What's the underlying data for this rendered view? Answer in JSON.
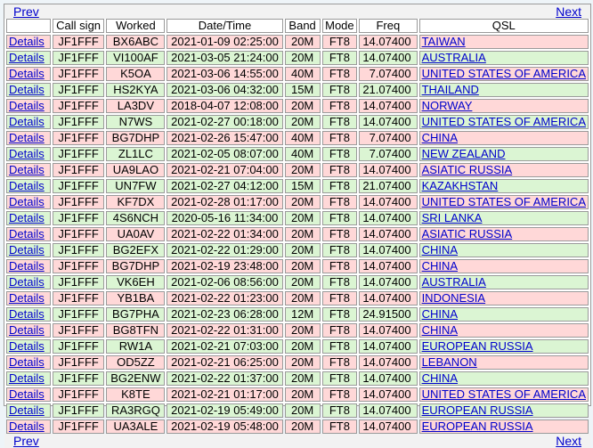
{
  "nav": {
    "prev": "Prev",
    "next": "Next"
  },
  "headers": {
    "details": "",
    "call_sign": "Call sign",
    "worked": "Worked",
    "datetime": "Date/Time",
    "band": "Band",
    "mode": "Mode",
    "freq": "Freq",
    "qsl": "QSL"
  },
  "details_label": "Details",
  "colors": {
    "pink_row": "#ffd8d8",
    "green_row": "#dbf5d3",
    "link": "#0000cc"
  },
  "rows": [
    {
      "call": "JF1FFF",
      "worked": "BX6ABC",
      "datetime": "2021-01-09 02:25:00",
      "band": "20M",
      "mode": "FT8",
      "freq": "14.07400",
      "qsl": "TAIWAN",
      "status": "pink"
    },
    {
      "call": "JF1FFF",
      "worked": "VI100AF",
      "datetime": "2021-03-05 21:24:00",
      "band": "20M",
      "mode": "FT8",
      "freq": "14.07400",
      "qsl": "AUSTRALIA",
      "status": "green"
    },
    {
      "call": "JF1FFF",
      "worked": "K5OA",
      "datetime": "2021-03-06 14:55:00",
      "band": "40M",
      "mode": "FT8",
      "freq": "7.07400",
      "qsl": "UNITED STATES OF AMERICA",
      "status": "pink"
    },
    {
      "call": "JF1FFF",
      "worked": "HS2KYA",
      "datetime": "2021-03-06 04:32:00",
      "band": "15M",
      "mode": "FT8",
      "freq": "21.07400",
      "qsl": "THAILAND",
      "status": "green"
    },
    {
      "call": "JF1FFF",
      "worked": "LA3DV",
      "datetime": "2018-04-07 12:08:00",
      "band": "20M",
      "mode": "FT8",
      "freq": "14.07400",
      "qsl": "NORWAY",
      "status": "pink"
    },
    {
      "call": "JF1FFF",
      "worked": "N7WS",
      "datetime": "2021-02-27 00:18:00",
      "band": "20M",
      "mode": "FT8",
      "freq": "14.07400",
      "qsl": "UNITED STATES OF AMERICA",
      "status": "green"
    },
    {
      "call": "JF1FFF",
      "worked": "BG7DHP",
      "datetime": "2021-02-26 15:47:00",
      "band": "40M",
      "mode": "FT8",
      "freq": "7.07400",
      "qsl": "CHINA",
      "status": "pink"
    },
    {
      "call": "JF1FFF",
      "worked": "ZL1LC",
      "datetime": "2021-02-05 08:07:00",
      "band": "40M",
      "mode": "FT8",
      "freq": "7.07400",
      "qsl": "NEW ZEALAND",
      "status": "green"
    },
    {
      "call": "JF1FFF",
      "worked": "UA9LAO",
      "datetime": "2021-02-21 07:04:00",
      "band": "20M",
      "mode": "FT8",
      "freq": "14.07400",
      "qsl": "ASIATIC RUSSIA",
      "status": "pink"
    },
    {
      "call": "JF1FFF",
      "worked": "UN7FW",
      "datetime": "2021-02-27 04:12:00",
      "band": "15M",
      "mode": "FT8",
      "freq": "21.07400",
      "qsl": "KAZAKHSTAN",
      "status": "green"
    },
    {
      "call": "JF1FFF",
      "worked": "KF7DX",
      "datetime": "2021-02-28 01:17:00",
      "band": "20M",
      "mode": "FT8",
      "freq": "14.07400",
      "qsl": "UNITED STATES OF AMERICA",
      "status": "pink"
    },
    {
      "call": "JF1FFF",
      "worked": "4S6NCH",
      "datetime": "2020-05-16 11:34:00",
      "band": "20M",
      "mode": "FT8",
      "freq": "14.07400",
      "qsl": "SRI LANKA",
      "status": "green"
    },
    {
      "call": "JF1FFF",
      "worked": "UA0AV",
      "datetime": "2021-02-22 01:34:00",
      "band": "20M",
      "mode": "FT8",
      "freq": "14.07400",
      "qsl": "ASIATIC RUSSIA",
      "status": "pink"
    },
    {
      "call": "JF1FFF",
      "worked": "BG2EFX",
      "datetime": "2021-02-22 01:29:00",
      "band": "20M",
      "mode": "FT8",
      "freq": "14.07400",
      "qsl": "CHINA",
      "status": "green"
    },
    {
      "call": "JF1FFF",
      "worked": "BG7DHP",
      "datetime": "2021-02-19 23:48:00",
      "band": "20M",
      "mode": "FT8",
      "freq": "14.07400",
      "qsl": "CHINA",
      "status": "pink"
    },
    {
      "call": "JF1FFF",
      "worked": "VK6EH",
      "datetime": "2021-02-06 08:56:00",
      "band": "20M",
      "mode": "FT8",
      "freq": "14.07400",
      "qsl": "AUSTRALIA",
      "status": "green"
    },
    {
      "call": "JF1FFF",
      "worked": "YB1BA",
      "datetime": "2021-02-22 01:23:00",
      "band": "20M",
      "mode": "FT8",
      "freq": "14.07400",
      "qsl": "INDONESIA",
      "status": "pink"
    },
    {
      "call": "JF1FFF",
      "worked": "BG7PHA",
      "datetime": "2021-02-23 06:28:00",
      "band": "12M",
      "mode": "FT8",
      "freq": "24.91500",
      "qsl": "CHINA",
      "status": "green"
    },
    {
      "call": "JF1FFF",
      "worked": "BG8TFN",
      "datetime": "2021-02-22 01:31:00",
      "band": "20M",
      "mode": "FT8",
      "freq": "14.07400",
      "qsl": "CHINA",
      "status": "pink"
    },
    {
      "call": "JF1FFF",
      "worked": "RW1A",
      "datetime": "2021-02-21 07:03:00",
      "band": "20M",
      "mode": "FT8",
      "freq": "14.07400",
      "qsl": "EUROPEAN RUSSIA",
      "status": "green"
    },
    {
      "call": "JF1FFF",
      "worked": "OD5ZZ",
      "datetime": "2021-02-21 06:25:00",
      "band": "20M",
      "mode": "FT8",
      "freq": "14.07400",
      "qsl": "LEBANON",
      "status": "pink"
    },
    {
      "call": "JF1FFF",
      "worked": "BG2ENW",
      "datetime": "2021-02-22 01:37:00",
      "band": "20M",
      "mode": "FT8",
      "freq": "14.07400",
      "qsl": "CHINA",
      "status": "green"
    },
    {
      "call": "JF1FFF",
      "worked": "K8TE",
      "datetime": "2021-02-21 01:17:00",
      "band": "20M",
      "mode": "FT8",
      "freq": "14.07400",
      "qsl": "UNITED STATES OF AMERICA",
      "status": "pink"
    },
    {
      "call": "JF1FFF",
      "worked": "RA3RGQ",
      "datetime": "2021-02-19 05:49:00",
      "band": "20M",
      "mode": "FT8",
      "freq": "14.07400",
      "qsl": "EUROPEAN RUSSIA",
      "status": "green"
    },
    {
      "call": "JF1FFF",
      "worked": "UA3ALE",
      "datetime": "2021-02-19 05:48:00",
      "band": "20M",
      "mode": "FT8",
      "freq": "14.07400",
      "qsl": "EUROPEAN RUSSIA",
      "status": "pink"
    }
  ]
}
